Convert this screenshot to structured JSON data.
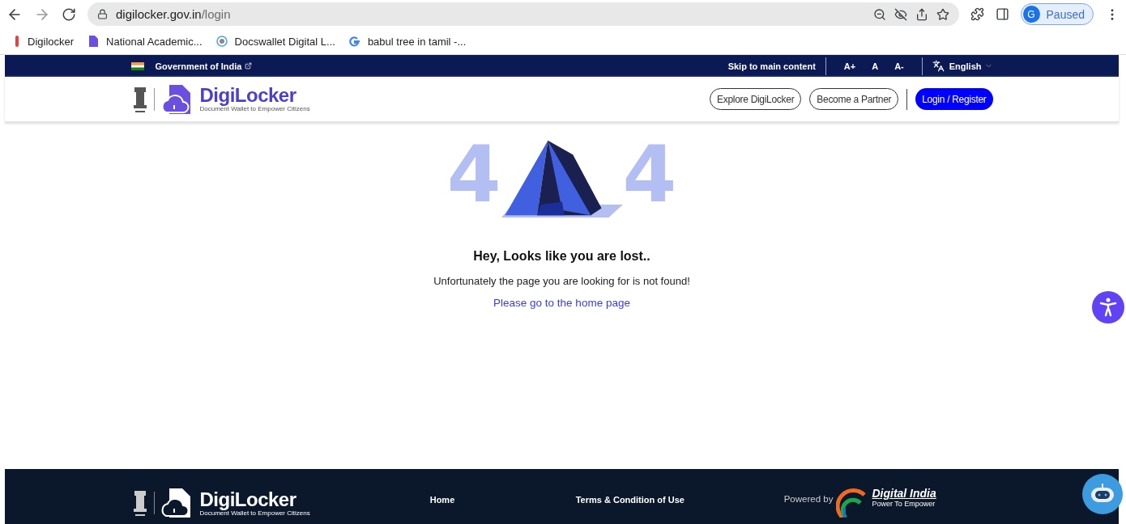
{
  "browser": {
    "url_host": "digilocker.gov.in",
    "url_path": "/login",
    "profile_initial": "G",
    "profile_status": "Paused",
    "bookmarks": [
      {
        "label": "Digilocker",
        "kind": "red"
      },
      {
        "label": "National Academic...",
        "kind": "doc"
      },
      {
        "label": "Docswallet Digital L...",
        "kind": "ring"
      },
      {
        "label": "babul tree in tamil -...",
        "kind": "google"
      }
    ]
  },
  "gov_bar": {
    "title": "Government of India",
    "skip_link": "Skip to main content",
    "font_sizes": [
      "A+",
      "A",
      "A-"
    ],
    "language": "English"
  },
  "header": {
    "logo_name": "DigiLocker",
    "logo_tagline": "Document Wallet to Empower Citizens",
    "buttons": [
      {
        "label": "Explore DigiLocker",
        "kind": "outline"
      },
      {
        "label": "Become a Partner",
        "kind": "outline"
      },
      {
        "label": "Login / Register",
        "kind": "primary"
      }
    ]
  },
  "error": {
    "code_digits": [
      "4",
      "4"
    ],
    "heading": "Hey, Looks like you are lost..",
    "message": "Unfortunately the page you are looking for is not found!",
    "link": "Please go to the home page"
  },
  "footer": {
    "logo_name": "DigiLocker",
    "logo_tagline": "Document Wallet to Empower Citizens",
    "links": [
      "Home",
      "Terms & Condition of Use"
    ],
    "powered_by": "Powered by",
    "partner_name": "Digital India",
    "partner_tagline": "Power To Empower"
  }
}
